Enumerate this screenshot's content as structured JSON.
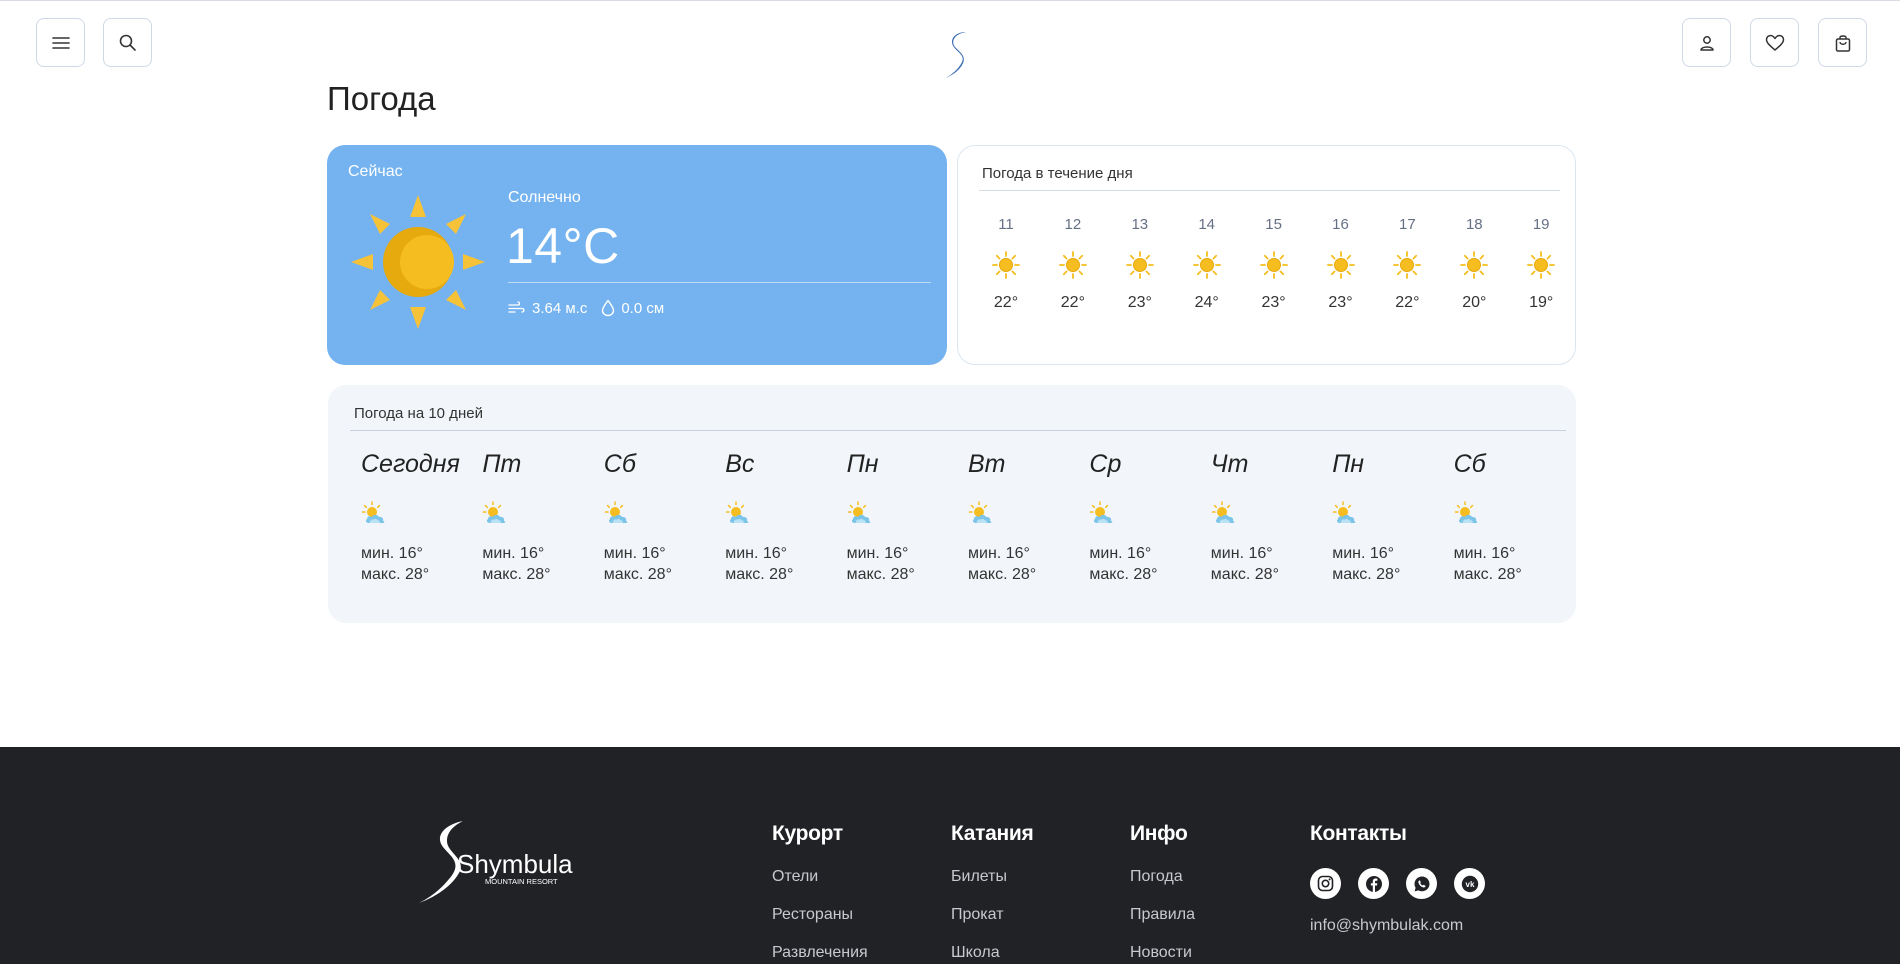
{
  "header": {
    "menu_icon": "hamburger-menu-icon",
    "search_icon": "search-icon",
    "logo": "shymbulak-s-logo",
    "account_icon": "user-icon",
    "wishlist_icon": "heart-icon",
    "cart_icon": "shopping-bag-icon"
  },
  "page": {
    "title": "Погода"
  },
  "now": {
    "label": "Сейчас",
    "condition": "Солнечно",
    "temperature": "14°C",
    "wind": "3.64 м.с",
    "precipitation": "0.0 см",
    "icon": "sun-icon"
  },
  "hourly": {
    "title": "Погода в течение дня",
    "hours": [
      {
        "time": "11",
        "temp": "22°"
      },
      {
        "time": "12",
        "temp": "22°"
      },
      {
        "time": "13",
        "temp": "23°"
      },
      {
        "time": "14",
        "temp": "24°"
      },
      {
        "time": "15",
        "temp": "23°"
      },
      {
        "time": "16",
        "temp": "23°"
      },
      {
        "time": "17",
        "temp": "22°"
      },
      {
        "time": "18",
        "temp": "20°"
      },
      {
        "time": "19",
        "temp": "19°"
      }
    ]
  },
  "ten_day": {
    "title": "Погода на 10 дней",
    "days": [
      {
        "name": "Сегодня",
        "min": "мин. 16°",
        "max": "макс. 28°"
      },
      {
        "name": "Пт",
        "min": "мин. 16°",
        "max": "макс. 28°"
      },
      {
        "name": "Сб",
        "min": "мин. 16°",
        "max": "макс. 28°"
      },
      {
        "name": "Вс",
        "min": "мин. 16°",
        "max": "макс. 28°"
      },
      {
        "name": "Пн",
        "min": "мин. 16°",
        "max": "макс. 28°"
      },
      {
        "name": "Вт",
        "min": "мин. 16°",
        "max": "макс. 28°"
      },
      {
        "name": "Ср",
        "min": "мин. 16°",
        "max": "макс. 28°"
      },
      {
        "name": "Чт",
        "min": "мин. 16°",
        "max": "макс. 28°"
      },
      {
        "name": "Пн",
        "min": "мин. 16°",
        "max": "макс. 28°"
      },
      {
        "name": "Сб",
        "min": "мин. 16°",
        "max": "макс. 28°"
      }
    ]
  },
  "footer": {
    "logo_text": "Shymbulak",
    "logo_subtext": "MOUNTAIN RESORT",
    "columns": [
      {
        "title": "Курорт",
        "links": [
          "Отели",
          "Рестораны",
          "Развлечения"
        ]
      },
      {
        "title": "Катания",
        "links": [
          "Билеты",
          "Прокат",
          "Школа"
        ]
      },
      {
        "title": "Инфо",
        "links": [
          "Погода",
          "Правила",
          "Новости"
        ]
      }
    ],
    "contacts": {
      "title": "Контакты",
      "email": "info@shymbulak.com",
      "socials": [
        "instagram-icon",
        "facebook-icon",
        "whatsapp-icon",
        "vk-icon"
      ]
    }
  },
  "colors": {
    "now_card_bg": "#74b3ef",
    "ten_day_bg": "#f2f6fb",
    "footer_bg": "#212226",
    "sun_yellow": "#f5bd1f"
  }
}
